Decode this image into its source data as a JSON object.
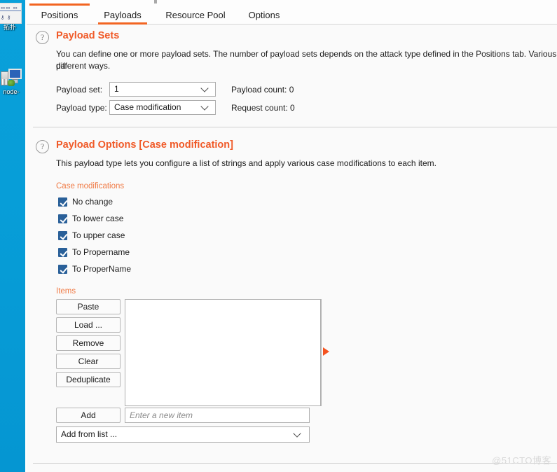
{
  "desktop": {
    "icons": [
      {
        "name": "network-topology-icon",
        "label": "拓扑"
      },
      {
        "name": "computer-node-icon",
        "label": "node-"
      }
    ]
  },
  "window": {
    "cut_tab_label": "",
    "tabs": [
      {
        "label": "Positions",
        "active": false
      },
      {
        "label": "Payloads",
        "active": true
      },
      {
        "label": "Resource Pool",
        "active": false
      },
      {
        "label": "Options",
        "active": false
      }
    ]
  },
  "payload_sets": {
    "help_icon": "question-mark-icon",
    "title": "Payload Sets",
    "description": "You can define one or more payload sets. The number of payload sets depends on the attack type defined in the Positions tab. Various pa",
    "description_line2": "different ways.",
    "payload_set_label": "Payload set:",
    "payload_set_value": "1",
    "payload_type_label": "Payload type:",
    "payload_type_value": "Case modification",
    "payload_count_label": "Payload count:  0",
    "request_count_label": "Request count:  0"
  },
  "payload_options": {
    "help_icon": "question-mark-icon",
    "title": "Payload Options [Case modification]",
    "description": "This payload type lets you configure a list of strings and apply various case modifications to each item.",
    "case_modifications_label": "Case modifications",
    "case_modifications": [
      {
        "label": "No change",
        "checked": true
      },
      {
        "label": "To lower case",
        "checked": true
      },
      {
        "label": "To upper case",
        "checked": true
      },
      {
        "label": "To Propername",
        "checked": true
      },
      {
        "label": "To ProperName",
        "checked": true
      }
    ],
    "items_label": "Items",
    "item_buttons": [
      {
        "label": "Paste"
      },
      {
        "label": "Load ..."
      },
      {
        "label": "Remove"
      },
      {
        "label": "Clear"
      },
      {
        "label": "Deduplicate"
      }
    ],
    "list_items": [],
    "add_button_label": "Add",
    "new_item_placeholder": "Enter a new item",
    "new_item_value": "",
    "add_from_list_label": "Add from list ..."
  },
  "watermark": "@51CTO博客",
  "colors": {
    "accent_orange": "#f26522",
    "title_orange": "#f05a28",
    "subhead_orange": "#f07b46",
    "checkbox_blue": "#2a6099",
    "desktop_blue": "#0b9fd8",
    "arrow_orange": "#f4521f"
  }
}
